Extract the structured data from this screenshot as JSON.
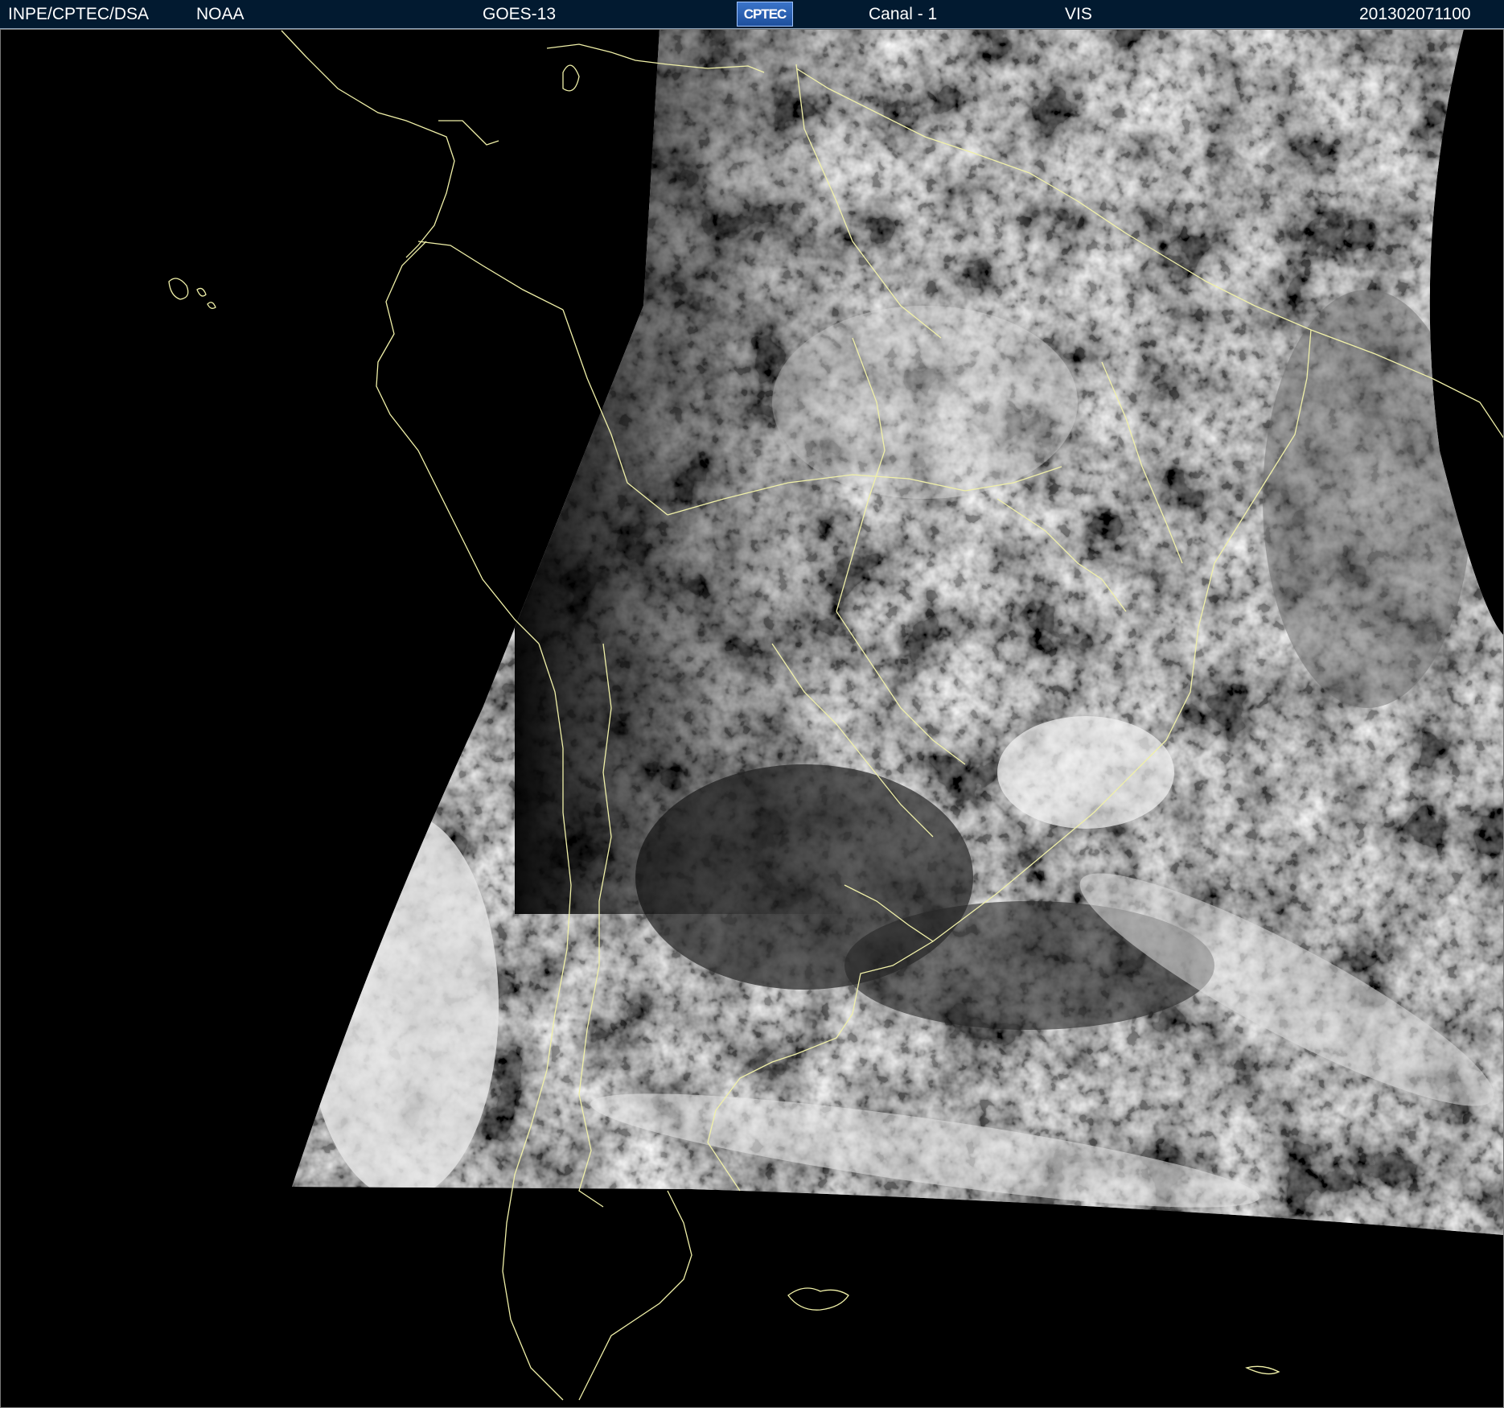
{
  "header": {
    "org": "INPE/CPTEC/DSA",
    "agency": "NOAA",
    "satellite": "GOES-13",
    "logo_text": "CPTEC",
    "channel": "Canal - 1",
    "band": "VIS",
    "timestamp": "201302071100"
  },
  "colors": {
    "header_bg": "#021a30",
    "header_text": "#ffffff",
    "coastline": "#f0f0a8",
    "space": "#000000"
  }
}
